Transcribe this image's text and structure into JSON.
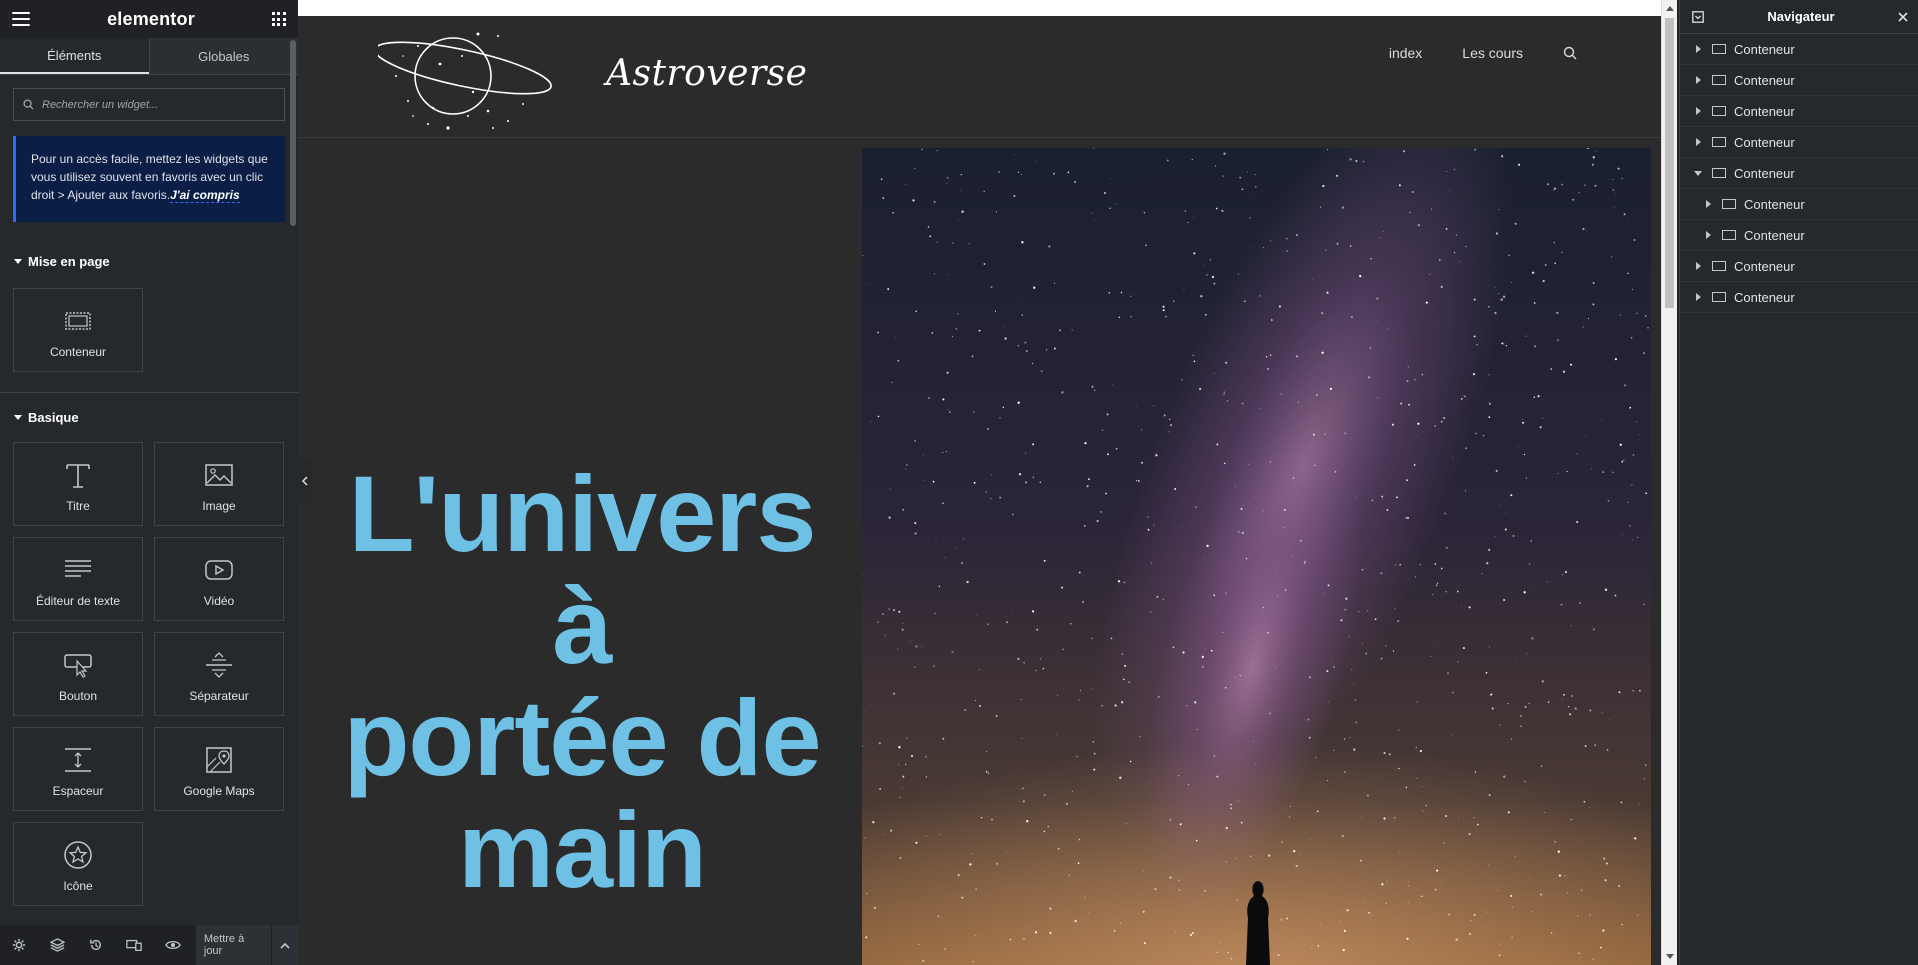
{
  "panel": {
    "brand": "elementor",
    "tabs": [
      {
        "label": "Éléments"
      },
      {
        "label": "Globales"
      }
    ],
    "search_placeholder": "Rechercher un widget...",
    "notice_text": "Pour un accès facile, mettez les widgets que vous utilisez souvent en favoris avec un clic droit > Ajouter aux favoris.",
    "notice_link": "J'ai compris",
    "section_layout": "Mise en page",
    "section_basic": "Basique",
    "widgets_layout": [
      {
        "label": "Conteneur",
        "icon": "container-icon"
      }
    ],
    "widgets_basic": [
      {
        "label": "Titre",
        "icon": "heading-icon"
      },
      {
        "label": "Image",
        "icon": "image-icon"
      },
      {
        "label": "Éditeur de texte",
        "icon": "text-editor-icon"
      },
      {
        "label": "Vidéo",
        "icon": "video-icon"
      },
      {
        "label": "Bouton",
        "icon": "button-icon"
      },
      {
        "label": "Séparateur",
        "icon": "divider-icon"
      },
      {
        "label": "Espaceur",
        "icon": "spacer-icon"
      },
      {
        "label": "Google Maps",
        "icon": "maps-icon"
      },
      {
        "label": "Icône",
        "icon": "star-icon"
      }
    ],
    "footer_update": "Mettre à jour"
  },
  "site": {
    "logo_text": "Astroverse",
    "nav": [
      {
        "label": "index"
      },
      {
        "label": "Les cours"
      }
    ],
    "hero_title_lines": [
      "L'univers à",
      "portée de",
      "main"
    ],
    "hero_title_color": "#6ec1e4"
  },
  "navigator": {
    "title": "Navigateur",
    "items": [
      {
        "label": "Conteneur",
        "depth": 0,
        "expanded": false
      },
      {
        "label": "Conteneur",
        "depth": 0,
        "expanded": false
      },
      {
        "label": "Conteneur",
        "depth": 0,
        "expanded": false
      },
      {
        "label": "Conteneur",
        "depth": 0,
        "expanded": false
      },
      {
        "label": "Conteneur",
        "depth": 0,
        "expanded": true
      },
      {
        "label": "Conteneur",
        "depth": 1,
        "expanded": false
      },
      {
        "label": "Conteneur",
        "depth": 1,
        "expanded": false
      },
      {
        "label": "Conteneur",
        "depth": 0,
        "expanded": false
      },
      {
        "label": "Conteneur",
        "depth": 0,
        "expanded": false
      }
    ]
  },
  "colors": {
    "panel_bg": "#26292c",
    "accent_blue": "#3568ff",
    "notice_bg": "#0b1e45",
    "site_bg": "#2b2b2b"
  }
}
